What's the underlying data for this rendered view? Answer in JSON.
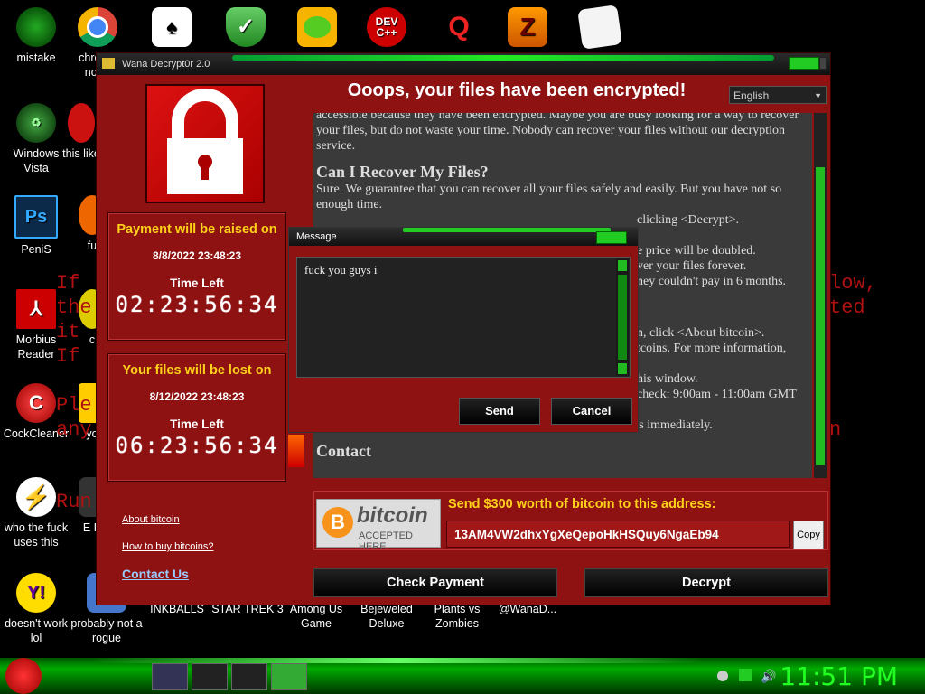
{
  "desktop_icons": [
    {
      "label": "mistake",
      "icon": "app-icon"
    },
    {
      "label": "chrome norm",
      "icon": "chrome-icon"
    },
    {
      "label": "",
      "icon": "cards-icon"
    },
    {
      "label": "",
      "icon": "shield-icon"
    },
    {
      "label": "",
      "icon": "bad-piggies-icon"
    },
    {
      "label": "",
      "icon": "devcpp-icon"
    },
    {
      "label": "",
      "icon": "q-icon"
    },
    {
      "label": "",
      "icon": "z-icon"
    },
    {
      "label": "",
      "icon": "paper-icon"
    },
    {
      "label": "Windows Vista",
      "icon": "recycle-icon"
    },
    {
      "label": "this like",
      "icon": "app-icon"
    },
    {
      "label": "PeniS",
      "icon": "photoshop-icon"
    },
    {
      "label": "fu",
      "icon": "app-icon"
    },
    {
      "label": "Morbius Reader",
      "icon": "pdf-icon"
    },
    {
      "label": "c",
      "icon": "app-icon"
    },
    {
      "label": "CockCleaner",
      "icon": "ccleaner-icon"
    },
    {
      "label": "yo",
      "icon": "app-icon"
    },
    {
      "label": "who the fuck uses this",
      "icon": "flash-icon"
    },
    {
      "label": "E E",
      "icon": "app-icon"
    },
    {
      "label": "doesn't work lol",
      "icon": "yahoo-icon"
    },
    {
      "label": "probably not a rogue",
      "icon": "app-icon"
    },
    {
      "label": "INKBALLS",
      "icon": "app-icon"
    },
    {
      "label": "STAR TREK 3",
      "icon": "app-icon"
    },
    {
      "label": "Among Us Game",
      "icon": "app-icon"
    },
    {
      "label": "Bejeweled Deluxe",
      "icon": "app-icon"
    },
    {
      "label": "Plants vs Zombies",
      "icon": "app-icon"
    },
    {
      "label": "@WanaD...",
      "icon": "app-icon"
    }
  ],
  "background_text": {
    "line1": "If",
    "line2": "the",
    "line3": "it",
    "line4": "If",
    "line5": "Ple",
    "line6": "any",
    "line7": "Run",
    "right1": "low,",
    "right2": "ted",
    "right3": "n"
  },
  "window": {
    "title": "Wana Decrypt0r 2.0",
    "headline": "Ooops, your files have been encrypted!",
    "language": "English",
    "payment_raise": {
      "label": "Payment will be raised on",
      "date": "8/8/2022 23:48:23",
      "time_left_label": "Time Left",
      "countdown": "02:23:56:34"
    },
    "files_lost": {
      "label": "Your files will be lost on",
      "date": "8/12/2022 23:48:23",
      "time_left_label": "Time Left",
      "countdown": "06:23:56:34"
    },
    "links": {
      "about_bitcoin": "About bitcoin",
      "how_to_buy": "How to buy bitcoins?",
      "contact": "Contact Us"
    },
    "body": {
      "para1": "accessible because they have been encrypted. Maybe you are busy looking for a way to recover your files, but do not waste your time. Nobody can recover your files without our decryption service.",
      "heading1": "Can I Recover My Files?",
      "para2": "Sure. We guarantee that you can recover all your files safely and easily. But you have not so enough time.",
      "frag1": "clicking <Decrypt>.",
      "frag2": "e price will be doubled.",
      "frag3": "ver your files forever.",
      "frag4": "ney couldn't pay in 6 months.",
      "frag5": "n, click <About bitcoin>.",
      "frag6": "tcoins. For more information,",
      "frag7": "his window.",
      "frag8": "check: 9:00am - 11:00am GMT",
      "para3": "Once the payment is checked, you can start decrypting your files immediately.",
      "heading2": "Contact"
    },
    "bitcoin": {
      "logo_text": "bitcoin",
      "logo_sub": "ACCEPTED HERE",
      "address_label": "Send $300 worth of bitcoin to this address:",
      "address": "13AM4VW2dhxYgXeQepoHkHSQuy6NgaEb94",
      "copy_label": "Copy"
    },
    "check_payment_label": "Check Payment",
    "decrypt_label": "Decrypt"
  },
  "dialog": {
    "title": "Message",
    "text": "fuck you guys i",
    "send_label": "Send",
    "cancel_label": "Cancel"
  },
  "taskbar": {
    "clock": "11:51 PM"
  }
}
